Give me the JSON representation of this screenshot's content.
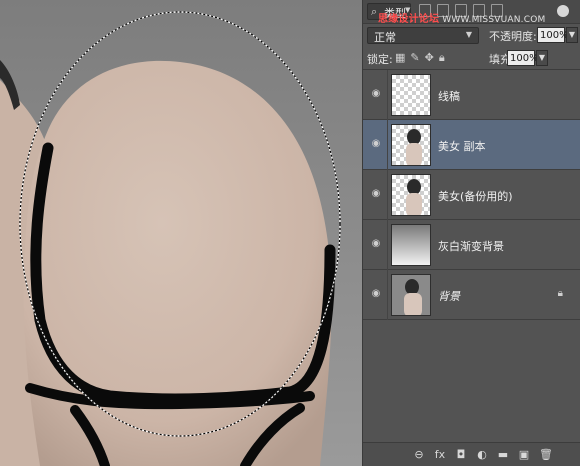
{
  "layers_panel": {
    "filter": {
      "icon": "search-icon",
      "kind_label": "类型"
    },
    "filter_icons": [
      "image-filter-icon",
      "adjustment-filter-icon",
      "type-filter-icon",
      "shape-filter-icon",
      "smart-object-filter-icon"
    ],
    "watermark": {
      "site_cn": "思缘设计论坛",
      "url": "WWW.MISSVUAN.COM"
    },
    "blend_mode": "正常",
    "opacity_label": "不透明度:",
    "opacity_value": "100%",
    "lock_label": "锁定:",
    "lock_icons": [
      "lock-transparent-icon",
      "lock-paint-icon",
      "lock-position-icon",
      "lock-all-icon"
    ],
    "fill_label": "填充:",
    "fill_value": "100%",
    "layers": [
      {
        "name": "线稿",
        "selected": false,
        "visible": true,
        "locked": false,
        "italic": false
      },
      {
        "name": "美女 副本",
        "selected": true,
        "visible": true,
        "locked": false,
        "italic": false
      },
      {
        "name": "美女(备份用的)",
        "selected": false,
        "visible": true,
        "locked": false,
        "italic": false
      },
      {
        "name": "灰白渐变背景",
        "selected": false,
        "visible": true,
        "locked": false,
        "italic": false
      },
      {
        "name": "背景",
        "selected": false,
        "visible": true,
        "locked": true,
        "italic": true
      }
    ],
    "bottom_icons": [
      "link-layers-icon",
      "fx-icon",
      "add-mask-icon",
      "adjustment-layer-icon",
      "new-group-icon",
      "new-layer-icon",
      "delete-layer-icon"
    ],
    "bottom_labels": {
      "link": "⊖",
      "fx": "fx",
      "mask": "◘",
      "adjust": "◐",
      "group": "▬",
      "new": "▣",
      "delete": "🗑"
    }
  },
  "colors": {
    "panel_bg": "#535353",
    "selected_row": "#5b6a7f",
    "canvas_bg": "#8a8a8a",
    "skin": "#d3beb1"
  }
}
